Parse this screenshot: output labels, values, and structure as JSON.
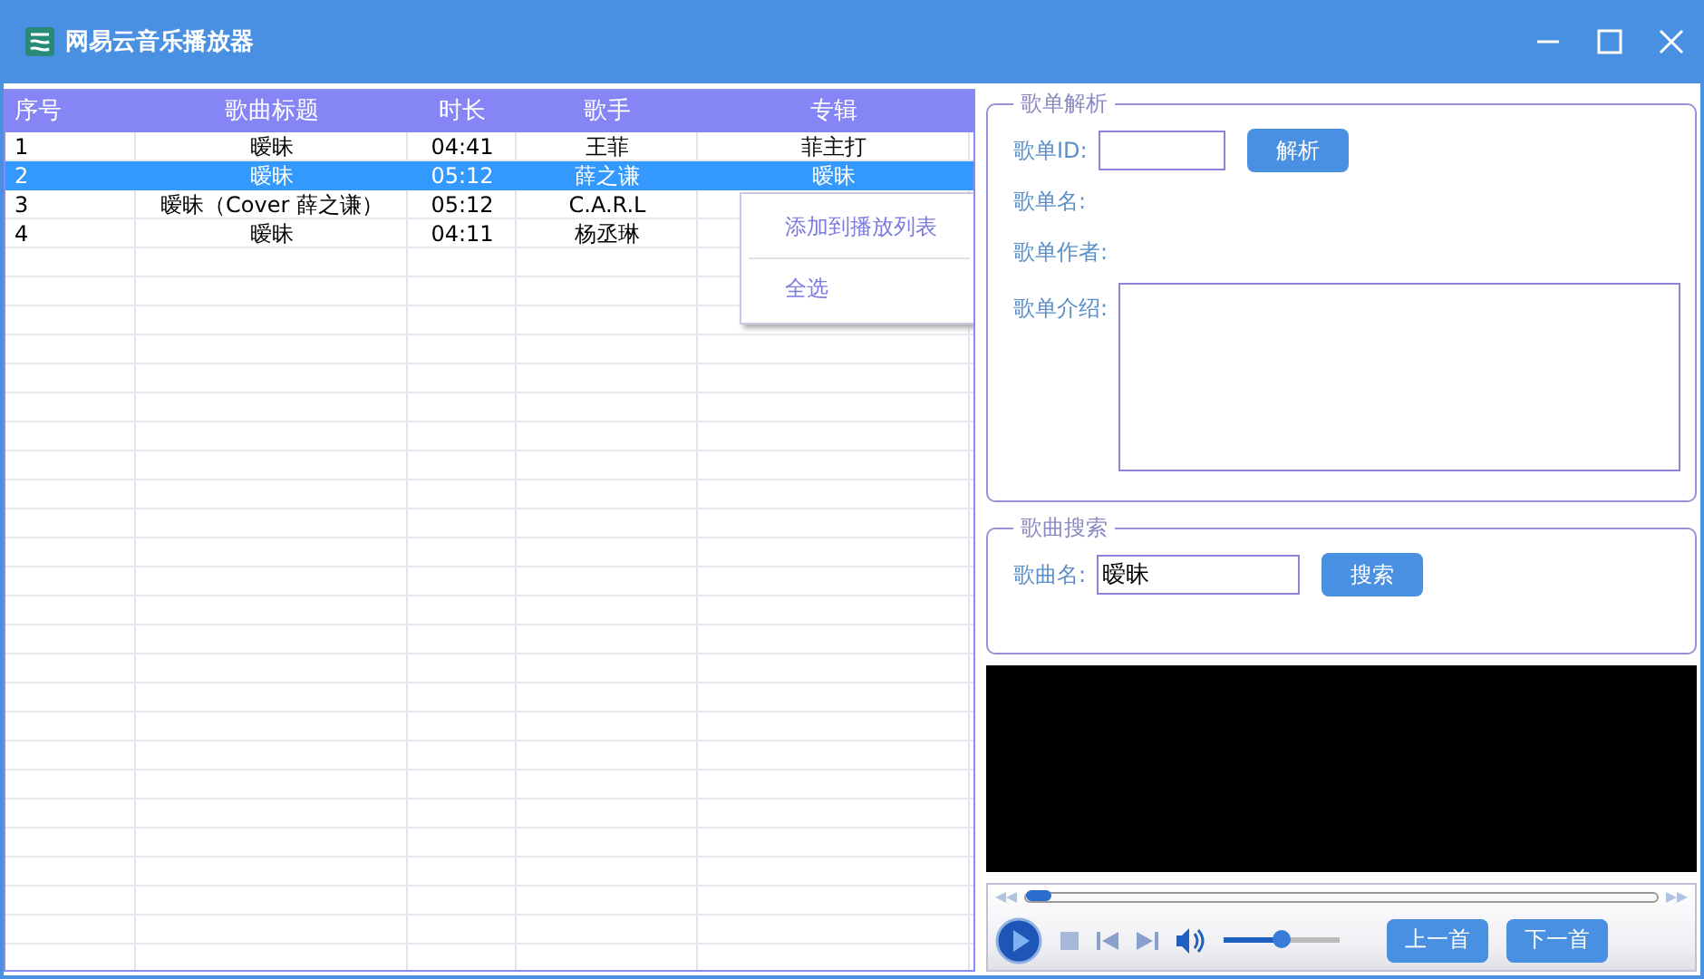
{
  "window": {
    "title": "网易云音乐播放器"
  },
  "table": {
    "columns": [
      "序号",
      "歌曲标题",
      "时长",
      "歌手",
      "专辑"
    ],
    "rows": [
      {
        "cells": [
          "1",
          "暧昧",
          "04:41",
          "王菲",
          "菲主打"
        ],
        "selected": false
      },
      {
        "cells": [
          "2",
          "暧昧",
          "05:12",
          "薛之谦",
          "暧昧"
        ],
        "selected": true
      },
      {
        "cells": [
          "3",
          "暧昧（Cover 薛之谦）",
          "05:12",
          "C.A.R.L",
          ""
        ],
        "selected": false
      },
      {
        "cells": [
          "4",
          "暧昧",
          "04:11",
          "杨丞琳",
          ""
        ],
        "selected": false
      }
    ]
  },
  "context_menu": {
    "items": [
      "添加到播放列表",
      "全选"
    ]
  },
  "playlist_parse": {
    "title": "歌单解析",
    "id_label": "歌单ID:",
    "parse_button": "解析",
    "name_label": "歌单名:",
    "author_label": "歌单作者:",
    "intro_label": "歌单介绍:"
  },
  "song_search": {
    "title": "歌曲搜索",
    "name_label": "歌曲名:",
    "value": "暧昧",
    "search_button": "搜索"
  },
  "player": {
    "progress": {
      "level": 0.02
    },
    "volume": {
      "level": 0.5
    },
    "prev_button": "上一首",
    "next_button": "下一首"
  }
}
